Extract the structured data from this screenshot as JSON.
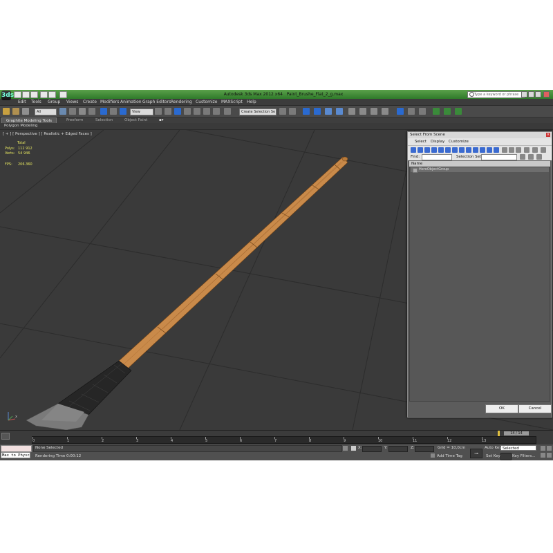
{
  "window": {
    "title": "Autodesk 3ds Max 2012 x64",
    "file": "Paint_Brushe_Flat_2_g.max",
    "logo": "3ds",
    "search_placeholder": "Type a keyword or phrase"
  },
  "menu": [
    "Edit",
    "Tools",
    "Group",
    "Views",
    "Create",
    "Modifiers",
    "Animation",
    "Graph Editors",
    "Rendering",
    "Customize",
    "MAXScript",
    "Help"
  ],
  "toolbar": {
    "filter": "All",
    "ref_coord": "View",
    "selection_set": "Create Selection Se"
  },
  "ribbon": {
    "tabs": [
      "Graphite Modeling Tools",
      "Freeform",
      "Selection",
      "Object Paint"
    ],
    "sub_label": "Polygon Modeling"
  },
  "viewport": {
    "label": "[ + ] [ Perspective ] [ Realistic + Edged Faces ]",
    "stats": {
      "total_label": "Total",
      "polys_label": "Polys:",
      "polys": "112 912",
      "verts_label": "Verts:",
      "verts": "54 946",
      "fps_label": "FPS:",
      "fps": "206.360"
    },
    "axis_label": "x"
  },
  "dialog": {
    "title": "Select From Scene",
    "close": "×",
    "menu": [
      "Select",
      "Display",
      "Customize"
    ],
    "find_label": "Find:",
    "selection_set_label": "Selection Set:",
    "column": "Name",
    "rows": [
      "HeroObjectGroup"
    ],
    "ok": "OK",
    "cancel": "Cancel"
  },
  "timeline": {
    "position": "14 / 14",
    "ticks": [
      "0",
      "1",
      "2",
      "3",
      "4",
      "5",
      "6",
      "7",
      "8",
      "9",
      "10",
      "11",
      "12",
      "13"
    ]
  },
  "status": {
    "maxscript": "Max to Physc",
    "selection": "None Selected",
    "render_time": "Rendering Time 0:00:12",
    "x_label": "X:",
    "y_label": "Y:",
    "z_label": "Z:",
    "grid": "Grid = 10,0cm",
    "add_time_tag": "Add Time Tag",
    "auto_key": "Auto Key",
    "auto_key_mode": "Selected",
    "set_key": "Set Key",
    "key_filters": "Key Filters..."
  },
  "colors": {
    "titlebar": "#3f8a35",
    "viewport": "#3a3a3a",
    "handle": "#c98a4a",
    "ferrule": "#2a2a2a",
    "bristles": "#7a7a7a",
    "stats": "#e8e860"
  }
}
